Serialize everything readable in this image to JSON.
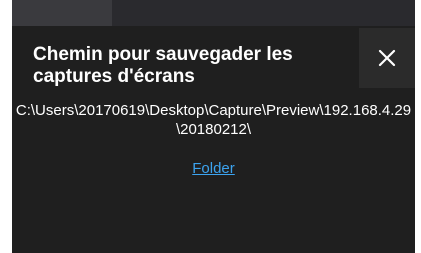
{
  "notification": {
    "title": "Chemin pour sauvegader les captures d'écrans",
    "path": "C:\\Users\\20170619\\Desktop\\Capture\\Preview\\192.168.4.29\\20180212\\",
    "link_label": "Folder",
    "close_icon": "close-icon"
  },
  "colors": {
    "background": "#1f1f1f",
    "close_bg": "#2b2b2b",
    "text": "#ffffff",
    "link": "#3ca3ef"
  }
}
